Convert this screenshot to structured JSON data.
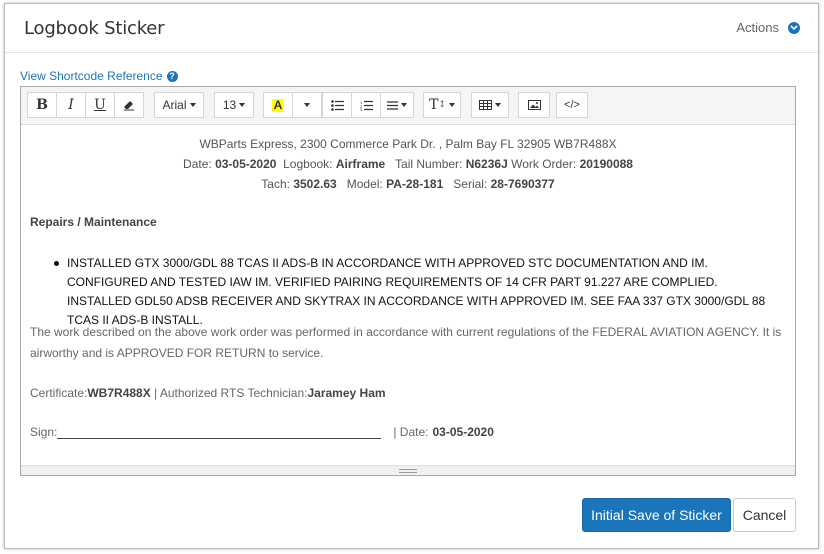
{
  "header": {
    "title": "Logbook Sticker",
    "actions_label": "Actions"
  },
  "shortcode_link": "View Shortcode Reference",
  "toolbar": {
    "bold": "B",
    "italic": "I",
    "underline": "U",
    "font_family": "Arial",
    "font_size": "13",
    "color_letter": "A",
    "text_height": "T",
    "code": "</>"
  },
  "document": {
    "company_line": "WBParts Express, 2300 Commerce Park Dr. , Palm Bay FL 32905 WB7R488X",
    "date_label": "Date:",
    "date_value": "03-05-2020",
    "logbook_label": "Logbook:",
    "logbook_value": "Airframe",
    "tail_label": "Tail Number:",
    "tail_value": "N6236J",
    "work_order_label": "Work Order:",
    "work_order_value": "20190088",
    "tach_label": "Tach:",
    "tach_value": "3502.63",
    "model_label": "Model:",
    "model_value": "PA-28-181",
    "serial_label": "Serial:",
    "serial_value": "28-7690377",
    "section_title": "Repairs / Maintenance",
    "repair_items": [
      "INSTALLED GTX 3000/GDL 88 TCAS II ADS-B IN ACCORDANCE WITH APPROVED STC DOCUMENTATION AND IM. CONFIGURED AND TESTED IAW IM. VERIFIED PAIRING REQUIREMENTS OF 14 CFR PART 91.227 ARE COMPLIED. INSTALLED GDL50 ADSB RECEIVER AND SKYTRAX IN ACCORDANCE WITH APPROVED IM. SEE FAA 337 GTX 3000/GDL 88 TCAS II ADS-B INSTALL."
    ],
    "statement": "The work described on the above work order was performed in accordance with current regulations of the FEDERAL AVIATION AGENCY. It is airworthy and is APPROVED FOR RETURN to service.",
    "certificate_label": "Certificate:",
    "certificate_value": "WB7R488X",
    "technician_label": " | Authorized RTS Technician:",
    "technician_value": "Jaramey Ham",
    "sign_label": "Sign:",
    "sign_date_label": "| Date:",
    "sign_date_value": "03-05-2020"
  },
  "buttons": {
    "save": "Initial Save of Sticker",
    "cancel": "Cancel"
  },
  "colors": {
    "accent": "#1b75bb",
    "highlight": "#ffff00"
  }
}
